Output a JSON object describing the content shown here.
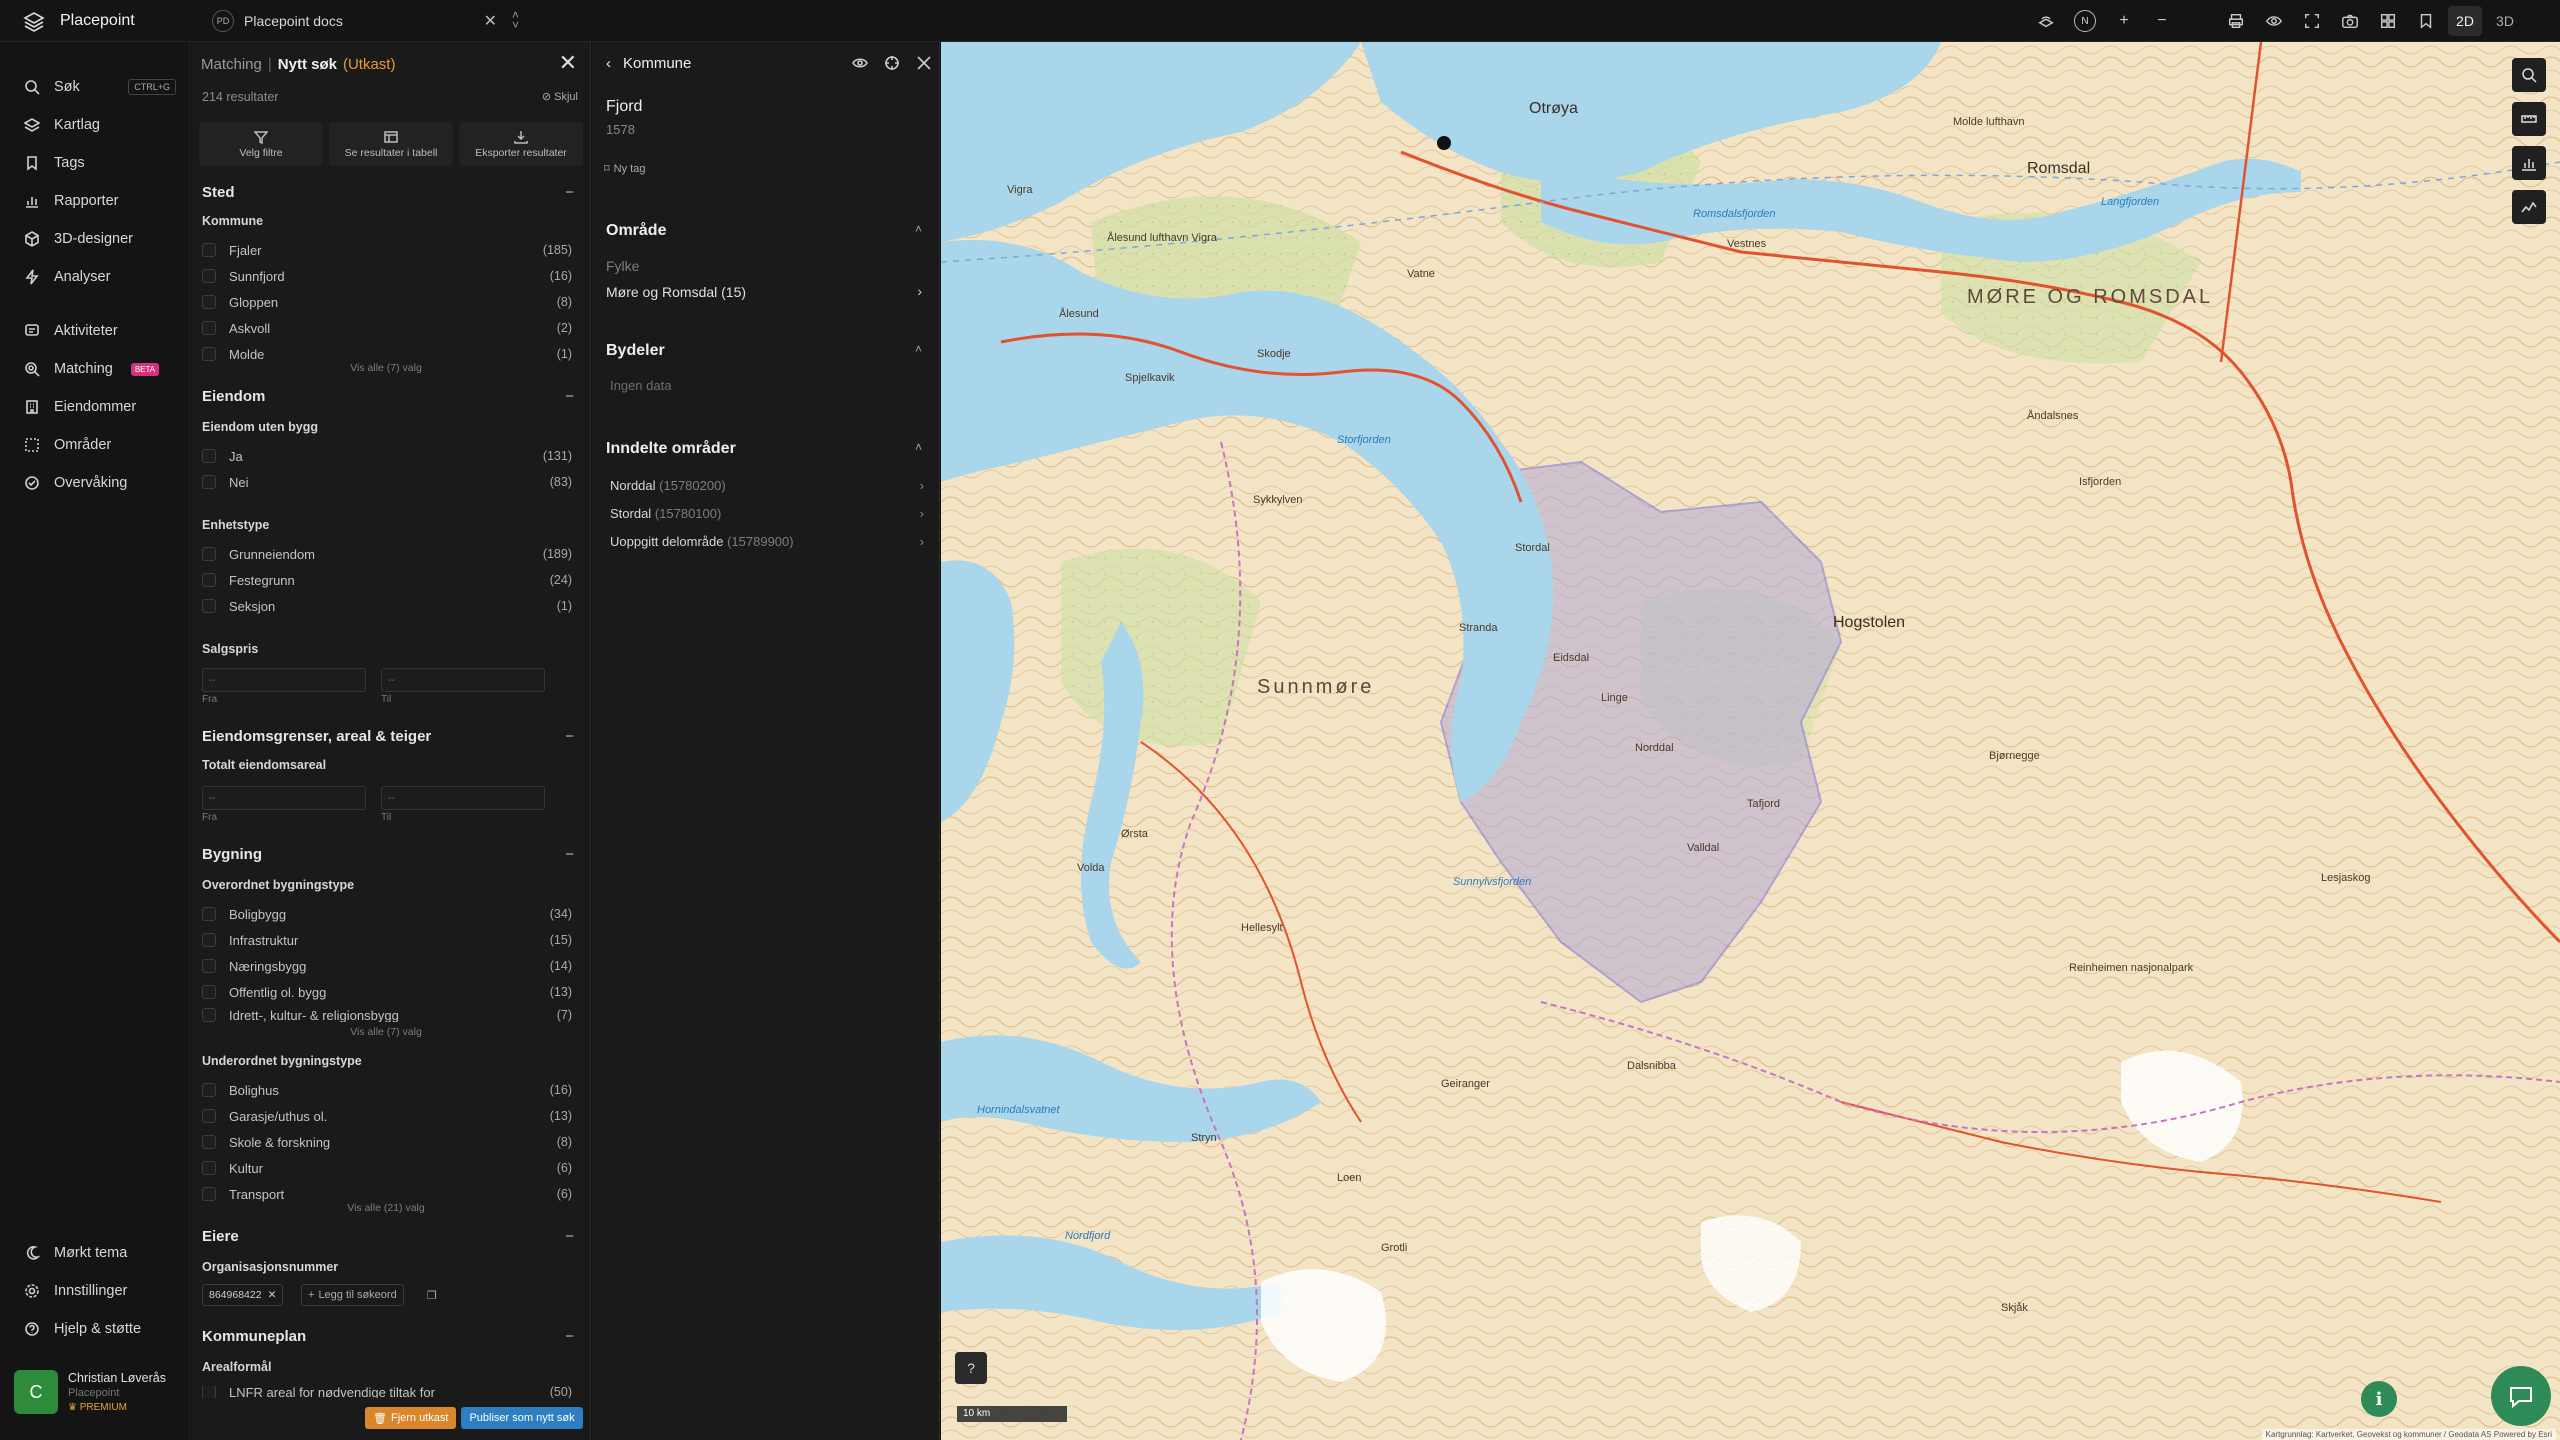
{
  "brand": {
    "name": "Placepoint"
  },
  "doc_select": {
    "badge": "PD",
    "label": "Placepoint docs"
  },
  "sidebar": {
    "items": [
      {
        "label": "Søk",
        "shortcut": "CTRL+G"
      },
      {
        "label": "Kartlag"
      },
      {
        "label": "Tags"
      },
      {
        "label": "Rapporter"
      },
      {
        "label": "3D-designer"
      },
      {
        "label": "Analyser"
      },
      {
        "label": "Aktiviteter"
      },
      {
        "label": "Matching",
        "badge": "BETA"
      },
      {
        "label": "Eiendommer"
      },
      {
        "label": "Områder"
      },
      {
        "label": "Overvåking"
      },
      {
        "label": "Mørkt tema"
      },
      {
        "label": "Innstillinger"
      },
      {
        "label": "Hjelp & støtte"
      }
    ],
    "user": {
      "initial": "C",
      "name": "Christian Løverås",
      "org": "Placepoint",
      "plan": "PREMIUM"
    }
  },
  "filter": {
    "crumb": "Matching",
    "separator": "|",
    "title": "Nytt søk",
    "draft": "(Utkast)",
    "result_count": "214 resultater",
    "hide_label": "Skjul",
    "actions": [
      "Velg filtre",
      "Se resultater i tabell",
      "Eksporter resultater"
    ],
    "sections": {
      "sted": {
        "title": "Sted",
        "kommune_label": "Kommune",
        "options": [
          {
            "label": "Fjaler",
            "count": "(185)"
          },
          {
            "label": "Sunnfjord",
            "count": "(16)"
          },
          {
            "label": "Gloppen",
            "count": "(8)"
          },
          {
            "label": "Askvoll",
            "count": "(2)"
          },
          {
            "label": "Molde",
            "count": "(1)"
          }
        ],
        "show_all": "Vis alle (7) valg"
      },
      "eiendom": {
        "title": "Eiendom",
        "uten_bygg_label": "Eiendom uten bygg",
        "uten_bygg": [
          {
            "label": "Ja",
            "count": "(131)"
          },
          {
            "label": "Nei",
            "count": "(83)"
          }
        ],
        "enhetstype_label": "Enhetstype",
        "enhetstype": [
          {
            "label": "Grunneiendom",
            "count": "(189)"
          },
          {
            "label": "Festegrunn",
            "count": "(24)"
          },
          {
            "label": "Seksjon",
            "count": "(1)"
          }
        ],
        "salgspris_label": "Salgspris",
        "from_label": "Fra",
        "to_label": "Til",
        "placeholder": "--"
      },
      "grenser": {
        "title": "Eiendomsgrenser, areal & teiger",
        "areal_label": "Totalt eiendomsareal"
      },
      "bygning": {
        "title": "Bygning",
        "overordnet_label": "Overordnet bygningstype",
        "overordnet": [
          {
            "label": "Boligbygg",
            "count": "(34)"
          },
          {
            "label": "Infrastruktur",
            "count": "(15)"
          },
          {
            "label": "Næringsbygg",
            "count": "(14)"
          },
          {
            "label": "Offentlig ol. bygg",
            "count": "(13)"
          },
          {
            "label": "Idrett-, kultur- & religionsbygg",
            "count": "(7)"
          }
        ],
        "overordnet_show_all": "Vis alle (7) valg",
        "underordnet_label": "Underordnet bygningstype",
        "underordnet": [
          {
            "label": "Bolighus",
            "count": "(16)"
          },
          {
            "label": "Garasje/uthus ol.",
            "count": "(13)"
          },
          {
            "label": "Skole & forskning",
            "count": "(8)"
          },
          {
            "label": "Kultur",
            "count": "(6)"
          },
          {
            "label": "Transport",
            "count": "(6)"
          }
        ],
        "underordnet_show_all": "Vis alle (21) valg"
      },
      "eiere": {
        "title": "Eiere",
        "org_label": "Organisasjonsnummer",
        "chip": "864968422",
        "add_keyword": "Legg til søkeord"
      },
      "kommuneplan": {
        "title": "Kommuneplan",
        "arealformal_label": "Arealformål",
        "first_option": {
          "label": "LNFR areal for nødvendige tiltak for",
          "count": "(50)"
        }
      }
    },
    "remove_draft": "Fjern utkast",
    "publish": "Publiser som nytt søk"
  },
  "detail": {
    "header": "Kommune",
    "name": "Fjord",
    "code": "1578",
    "new_tag": "Ny tag",
    "omrade": {
      "title": "Område",
      "fylke_label": "Fylke",
      "fylke_value": "Møre og Romsdal (15)"
    },
    "bydeler": {
      "title": "Bydeler",
      "empty": "Ingen data"
    },
    "inndelte": {
      "title": "Inndelte områder",
      "items": [
        {
          "name": "Norddal",
          "code": "(15780200)"
        },
        {
          "name": "Stordal",
          "code": "(15780100)"
        },
        {
          "name": "Uoppgitt delområde",
          "code": "(15789900)"
        }
      ]
    }
  },
  "topbar": {
    "dim_2d": "2D",
    "dim_3d": "3D",
    "compass": "N"
  },
  "map": {
    "scale": "10 km",
    "attribution": "Kartgrunnlag: Kartverket, Geovekst og kommuner / Geodata AS Powered by Esri",
    "places": {
      "region1": "MØRE OG ROMSDAL",
      "region2": "Sunnmøre",
      "romsdal": "Romsdal",
      "otroya": "Otrøya",
      "alesund": "Ålesund",
      "stordal": "Stordal",
      "norddal": "Norddal",
      "hogstolen": "Hogstolen",
      "bjornegge": "Bjørnegge",
      "reinheimen": "Reinheimen nasjonalpark",
      "geiranger": "Geiranger",
      "dalsnibba": "Dalsnibba",
      "stranda": "Stranda",
      "sykkylven": "Sykkylven",
      "tafjord": "Tafjord",
      "valldal": "Valldal",
      "linge": "Linge",
      "eidsdal": "Eidsdal",
      "hellesylt": "Hellesylt",
      "stryn": "Stryn",
      "loen": "Loen",
      "vestnes": "Vestnes",
      "andalsnes": "Åndalsnes",
      "isfjorden": "Isfjorden",
      "vatne": "Vatne",
      "skodje": "Skodje",
      "spjelkavik": "Spjelkavik",
      "orsta": "Ørsta",
      "volda": "Volda",
      "hornindalsvatnet": "Hornindalsvatnet",
      "nordfjord": "Nordfjord",
      "romsdalsfjorden": "Romsdalsfjorden",
      "storfjorden": "Storfjorden",
      "sunnylvsfjorden": "Sunnylvsfjorden",
      "langfjorden": "Langfjorden",
      "grotli": "Grotli",
      "skjak": "Skjåk",
      "lesja": "Lesjaskog",
      "molde_airport": "Molde lufthavn",
      "alesund_airport": "Ålesund lufthavn Vigra",
      "vigra": "Vigra"
    }
  }
}
